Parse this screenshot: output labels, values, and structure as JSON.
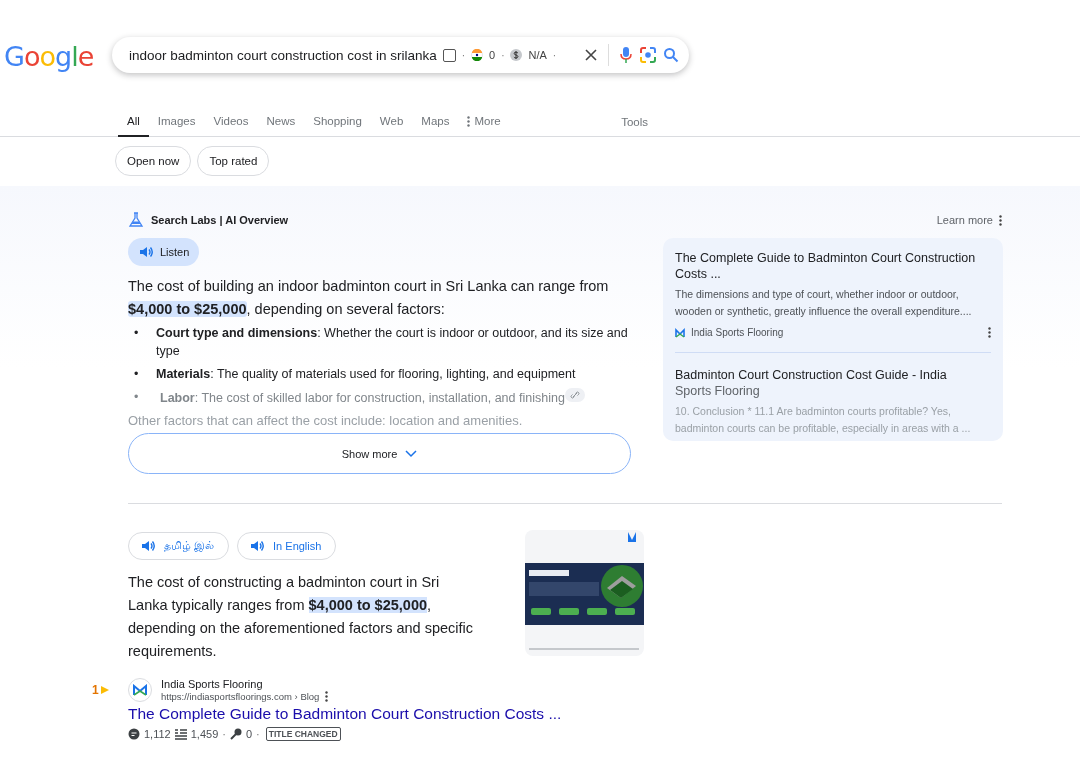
{
  "logo": "Google",
  "search": {
    "query": "indoor badminton court construction cost in srilanka",
    "checked": false,
    "flag_count": "0",
    "price": "N/A",
    "separators": [
      "·",
      "·",
      "·"
    ]
  },
  "tabs": [
    {
      "label": "All",
      "selected": true
    },
    {
      "label": "Images",
      "selected": false
    },
    {
      "label": "Videos",
      "selected": false
    },
    {
      "label": "News",
      "selected": false
    },
    {
      "label": "Shopping",
      "selected": false
    },
    {
      "label": "Web",
      "selected": false
    },
    {
      "label": "Maps",
      "selected": false
    },
    {
      "label": "More",
      "selected": false
    }
  ],
  "tools": "Tools",
  "chips": [
    "Open now",
    "Top rated"
  ],
  "ai_overview": {
    "title": "Search Labs | AI Overview",
    "learn_more": "Learn more",
    "listen": "Listen",
    "intro": "The cost of building an indoor badminton court in Sri Lanka can range from **$4,000 to $25,000**, depending on several factors:",
    "bullets": [
      {
        "marker": "•",
        "text": "**Court type and dimensions**: Whether the court is indoor or outdoor, and its size and type",
        "faded": false
      },
      {
        "marker": "•",
        "text": "**Materials**: The quality of materials used for flooring, lighting, and equipment",
        "faded": false
      },
      {
        "marker": "•",
        "text": "**Labor**: The cost of skilled labor for construction, installation, and finishing",
        "faded": true
      }
    ],
    "more_text": "Other factors that can affect the cost include: location and amenities.",
    "show_more": "Show more",
    "sources": [
      {
        "title": "The Complete Guide to Badminton Court Construction Costs ...",
        "snippet": "The dimensions and type of court, whether indoor or outdoor, wooden or synthetic, greatly influence the overall expenditure....",
        "site": "India Sports Flooring",
        "faded": false
      },
      {
        "title": "Badminton Court Construction Cost Guide - India",
        "subtitle": "Sports Flooring",
        "snippet": "10. Conclusion * 11.1 Are badminton courts profitable? Yes, badminton courts can be profitable, especially in areas with a ...",
        "faded": true
      }
    ]
  },
  "answer": {
    "languages": [
      "தமிழ் இல்",
      "In English"
    ],
    "text": "The cost of constructing a badminton court in Sri Lanka typically ranges from **$4,000 to $25,000**, depending on the aforementioned factors and specific requirements.",
    "image": {
      "kind": "picture"
    },
    "source": {
      "name": "India Sports Flooring",
      "url": "https://indiasportsfloorings.com › Blog",
      "rank": "1",
      "title": "The Complete Guide to Badminton Court Construction Costs ...",
      "stats": [
        {
          "kind": "comments",
          "value": "1,112"
        },
        {
          "kind": "words",
          "value": "1,459",
          "separator": "·"
        },
        {
          "kind": "keys",
          "value": "0",
          "separator": "·"
        }
      ],
      "badge": "TITLE CHANGED"
    }
  }
}
